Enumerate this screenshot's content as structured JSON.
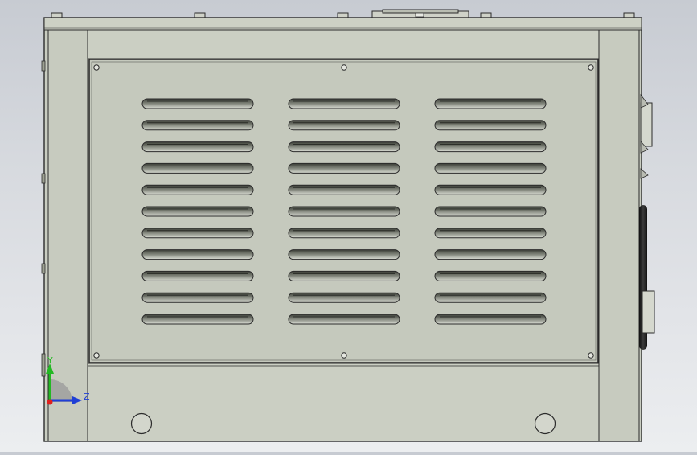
{
  "viewport": {
    "background_top": "#c7cbd2",
    "background_bottom": "#eceef0"
  },
  "model": {
    "body_color": "#c9cdc1",
    "panel_color": "#c5c9bd",
    "edge_color": "#2b2b2b",
    "louver_rows": 11,
    "louver_columns": 3
  },
  "triad": {
    "x_axis_color": "#e0201e",
    "y_axis_color": "#23b823",
    "z_axis_color": "#1f3fd6",
    "y_label": "Y",
    "z_label": "Z"
  }
}
